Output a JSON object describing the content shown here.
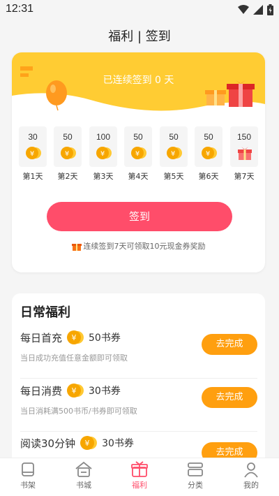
{
  "status_bar": {
    "time": "12:31"
  },
  "page": {
    "title": "福利 | 签到"
  },
  "signin": {
    "streak_text": "已连续签到 0 天",
    "days": [
      {
        "amount": "30",
        "label": "第1天",
        "reward": "coin"
      },
      {
        "amount": "50",
        "label": "第2天",
        "reward": "coin"
      },
      {
        "amount": "100",
        "label": "第3天",
        "reward": "coin"
      },
      {
        "amount": "50",
        "label": "第4天",
        "reward": "coin"
      },
      {
        "amount": "50",
        "label": "第5天",
        "reward": "coin"
      },
      {
        "amount": "50",
        "label": "第6天",
        "reward": "coin"
      },
      {
        "amount": "150",
        "label": "第7天",
        "reward": "gift"
      }
    ],
    "button_label": "签到",
    "tip": "连续签到7天可领取10元现金券奖励"
  },
  "daily": {
    "title": "日常福利",
    "tasks": [
      {
        "name": "每日首充",
        "reward": "50书券",
        "desc": "当日成功充值任意金额即可领取",
        "button": "去完成"
      },
      {
        "name": "每日消费",
        "reward": "30书券",
        "desc": "当日消耗满500书币/书券即可领取",
        "button": "去完成"
      },
      {
        "name": "阅读30分钟",
        "reward": "30书券",
        "desc": "",
        "button": "去完成"
      }
    ]
  },
  "tabs": [
    {
      "label": "书架",
      "icon": "bookshelf-icon"
    },
    {
      "label": "书城",
      "icon": "bookstore-icon"
    },
    {
      "label": "福利",
      "icon": "gift-icon",
      "active": true
    },
    {
      "label": "分类",
      "icon": "category-icon"
    },
    {
      "label": "我的",
      "icon": "profile-icon"
    }
  ],
  "colors": {
    "accent": "#ff4d6a",
    "banner": "#ffcc33",
    "task_button": "#ff9f0f",
    "coin": "#f7b500"
  }
}
